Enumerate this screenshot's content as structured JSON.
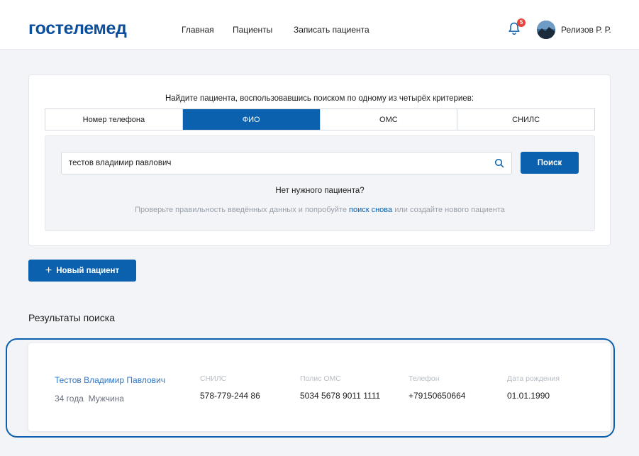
{
  "header": {
    "logo": "гостелемед",
    "nav": [
      "Главная",
      "Пациенты",
      "Записать пациента"
    ],
    "notifications_count": "5",
    "user_name": "Релизов Р. Р."
  },
  "search": {
    "hint": "Найдите пациента, воспользовавшись поиском по одному из четырёх критериев:",
    "tabs": [
      {
        "label": "Номер телефона",
        "active": false
      },
      {
        "label": "ФИО",
        "active": true
      },
      {
        "label": "ОМС",
        "active": false
      },
      {
        "label": "СНИЛС",
        "active": false
      }
    ],
    "query": "тестов владимир павлович",
    "button_label": "Поиск",
    "no_result_title": "Нет нужного пациента?",
    "no_result_prefix": "Проверьте правильность введённых данных и попробуйте ",
    "no_result_link": "поиск снова",
    "no_result_suffix": " или создайте нового пациента"
  },
  "new_patient_label": "Новый пациент",
  "results": {
    "title": "Результаты поиска",
    "items": [
      {
        "name": "Тестов Владимир Павлович",
        "age": "34 года",
        "gender": "Мужчина",
        "snils_label": "СНИЛС",
        "snils": "578-779-244 86",
        "oms_label": "Полис ОМС",
        "oms": "5034 5678 9011 1111",
        "phone_label": "Телефон",
        "phone": "+79150650664",
        "birth_label": "Дата рождения",
        "birth": "01.01.1990"
      }
    ]
  },
  "colors": {
    "brand": "#0b4e9c",
    "accent": "#0b61ad",
    "link": "#2f78c6",
    "badge": "#e8453c"
  }
}
